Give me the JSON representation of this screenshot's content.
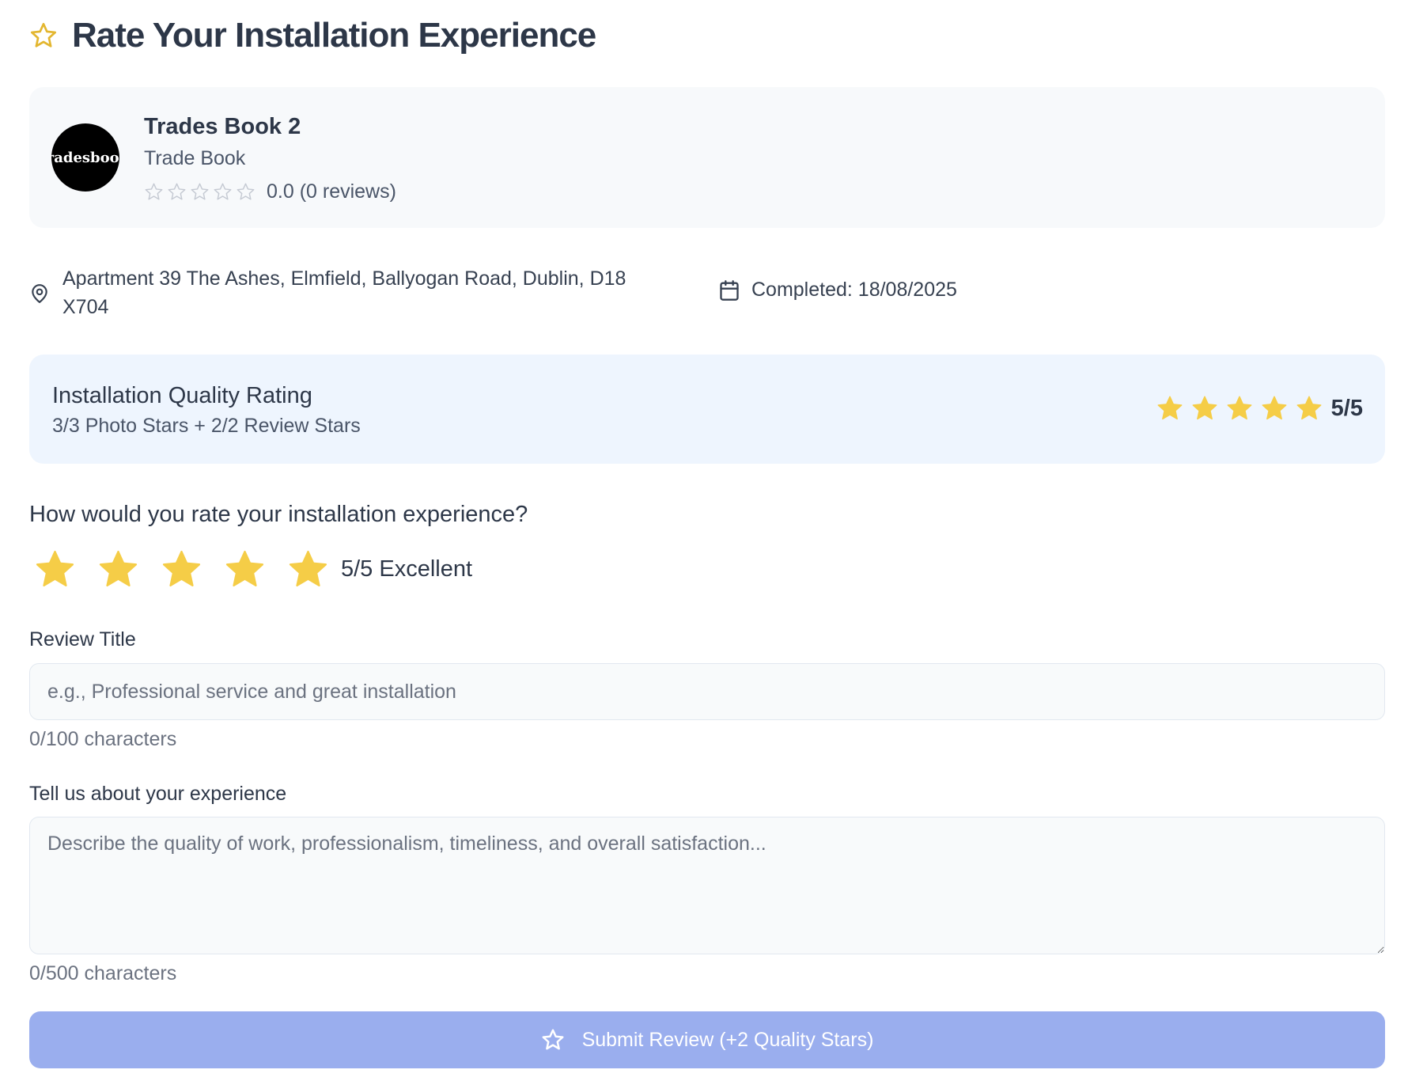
{
  "header": {
    "title": "Rate Your Installation Experience",
    "icon": "star-outline-icon",
    "icon_color": "#e3b62f"
  },
  "professional": {
    "logo_text": "Tradesbook.",
    "name": "Trades Book 2",
    "role": "Trade Book",
    "rating_text": "0.0 (0 reviews)",
    "rating_value": 0,
    "rating_max": 5
  },
  "job": {
    "address": "Apartment 39 The Ashes, Elmfield, Ballyogan Road, Dublin, D18 X704",
    "completed": "Completed: 18/08/2025",
    "location_icon": "map-pin-icon",
    "calendar_icon": "calendar-icon"
  },
  "quality": {
    "title": "Installation Quality Rating",
    "subtitle": "3/3 Photo Stars + 2/2 Review Stars",
    "score_text": "5/5",
    "stars_filled": 5,
    "stars_max": 5
  },
  "rating_question": {
    "question": "How would you rate your installation experience?",
    "selected": 5,
    "max": 5,
    "label": "5/5 Excellent"
  },
  "form": {
    "title_label": "Review Title",
    "title_placeholder": "e.g., Professional service and great installation",
    "title_value": "",
    "title_counter": "0/100 characters",
    "experience_label": "Tell us about your experience",
    "experience_placeholder": "Describe the quality of work, professionalism, timeliness, and overall satisfaction...",
    "experience_value": "",
    "experience_counter": "0/500 characters"
  },
  "submit": {
    "label": "Submit Review (+2 Quality Stars)",
    "icon": "star-outline-icon"
  },
  "colors": {
    "star_filled": "#f5cd47",
    "star_empty_stroke": "#c5cad3",
    "accent_star": "#e3b62f",
    "submit_bg": "#9aaeee"
  }
}
